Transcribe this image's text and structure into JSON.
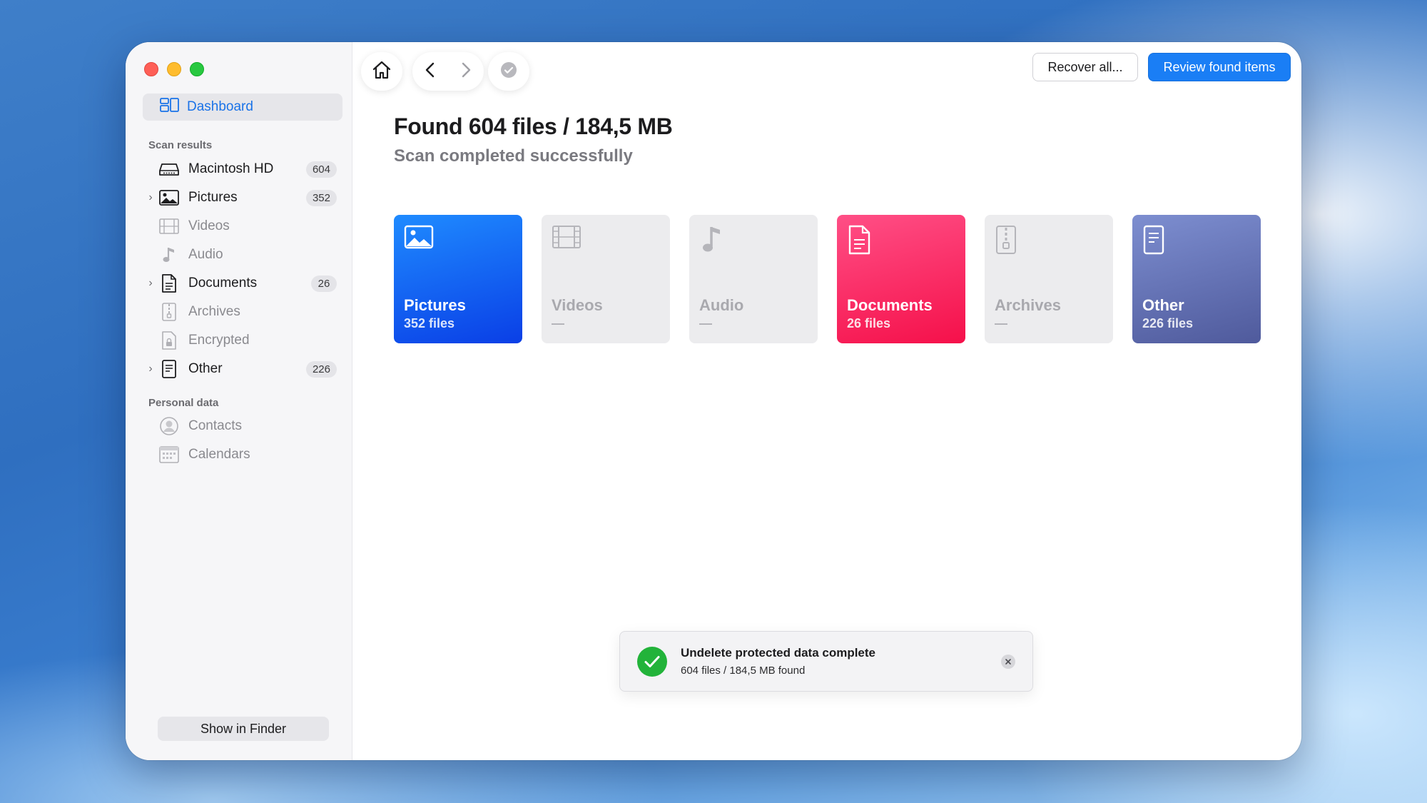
{
  "sidebar": {
    "dashboard_label": "Dashboard",
    "scan_results_label": "Scan results",
    "scan_items": [
      {
        "label": "Macintosh HD",
        "count": "604"
      },
      {
        "label": "Pictures",
        "count": "352"
      },
      {
        "label": "Videos"
      },
      {
        "label": "Audio"
      },
      {
        "label": "Documents",
        "count": "26"
      },
      {
        "label": "Archives"
      },
      {
        "label": "Encrypted"
      },
      {
        "label": "Other",
        "count": "226"
      }
    ],
    "personal_data_label": "Personal data",
    "personal_items": [
      {
        "label": "Contacts"
      },
      {
        "label": "Calendars"
      }
    ],
    "show_in_finder": "Show in Finder"
  },
  "toolbar": {
    "recover_all": "Recover all...",
    "review_found_items": "Review found items"
  },
  "main": {
    "title": "Found 604 files / 184,5 MB",
    "subtitle": "Scan completed successfully",
    "cards": [
      {
        "name": "Pictures",
        "count": "352 files"
      },
      {
        "name": "Videos",
        "count": "—"
      },
      {
        "name": "Audio",
        "count": "—"
      },
      {
        "name": "Documents",
        "count": "26 files"
      },
      {
        "name": "Archives",
        "count": "—"
      },
      {
        "name": "Other",
        "count": "226 files"
      }
    ]
  },
  "toast": {
    "title": "Undelete protected data complete",
    "message": "604 files / 184,5 MB found"
  },
  "colors": {
    "accent": "#1a7ef5",
    "pictures": "#0a3fe6",
    "documents": "#f5104a",
    "other": "#5a66a8",
    "success": "#22b33a"
  }
}
